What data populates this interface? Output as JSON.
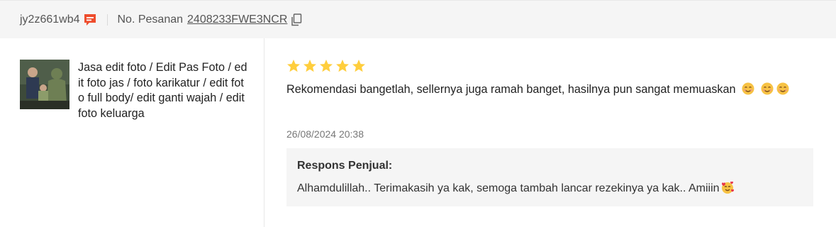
{
  "header": {
    "username": "jy2z661wb4",
    "chat_icon": "chat-bubble-icon",
    "order_label": "No. Pesanan",
    "order_number": "2408233FWE3NCR",
    "copy_icon": "copy-icon"
  },
  "product": {
    "name": "Jasa edit foto / Edit Pas Foto / edit foto jas / foto karikatur / edit foto full body/ edit ganti wajah / edit foto keluarga",
    "thumbnail_icon": "product-thumbnail"
  },
  "review": {
    "rating": 5,
    "rating_max": 5,
    "text": "Rekomendasi bangetlah, sellernya juga ramah banget, hasilnya pun sangat memuaskan",
    "emojis": [
      "smiling-face-icon",
      "smiling-face-icon",
      "smiling-face-icon"
    ],
    "timestamp": "26/08/2024 20:38"
  },
  "seller_response": {
    "title": "Respons Penjual:",
    "text": "Alhamdulillah.. Terimakasih ya kak, semoga tambah lancar rezekinya ya kak.. Amiiin",
    "emoji": "smiling-face-with-hearts-icon"
  },
  "colors": {
    "accent": "#ee4d2d",
    "star": "#ffce3d",
    "header_bg": "#f5f5f5"
  }
}
